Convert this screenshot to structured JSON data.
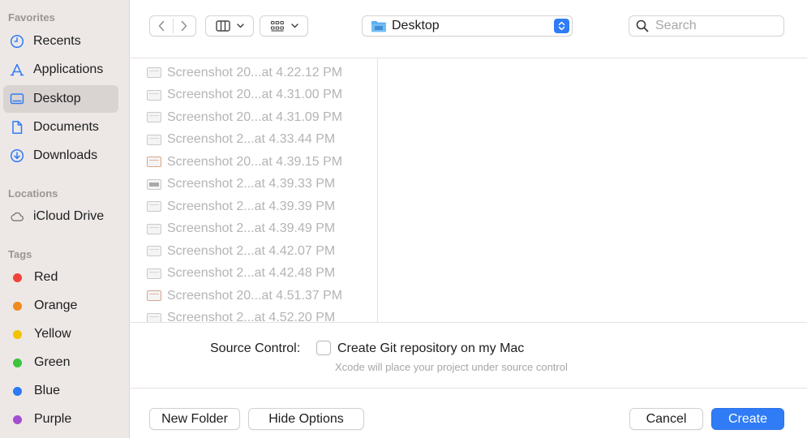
{
  "sidebar": {
    "favorites_header": "Favorites",
    "favorites": [
      {
        "label": "Recents",
        "icon": "clock-icon"
      },
      {
        "label": "Applications",
        "icon": "applications-icon"
      },
      {
        "label": "Desktop",
        "icon": "desktop-icon",
        "selected": true
      },
      {
        "label": "Documents",
        "icon": "document-icon"
      },
      {
        "label": "Downloads",
        "icon": "download-icon"
      }
    ],
    "locations_header": "Locations",
    "locations": [
      {
        "label": "iCloud Drive",
        "icon": "cloud-icon"
      }
    ],
    "tags_header": "Tags",
    "tags": [
      {
        "label": "Red",
        "color": "#f0443a"
      },
      {
        "label": "Orange",
        "color": "#f08a1c"
      },
      {
        "label": "Yellow",
        "color": "#f4c300"
      },
      {
        "label": "Green",
        "color": "#3cc43f"
      },
      {
        "label": "Blue",
        "color": "#2b7af6"
      },
      {
        "label": "Purple",
        "color": "#a34fd1"
      }
    ]
  },
  "toolbar": {
    "location": "Desktop",
    "search_placeholder": "Search"
  },
  "files": [
    {
      "name": "Screenshot 20...at 4.22.12 PM",
      "thumb": "light"
    },
    {
      "name": "Screenshot 20...at 4.31.00 PM",
      "thumb": "light"
    },
    {
      "name": "Screenshot 20...at 4.31.09 PM",
      "thumb": "light"
    },
    {
      "name": "Screenshot 2...at 4.33.44 PM",
      "thumb": "light"
    },
    {
      "name": "Screenshot 20...at 4.39.15 PM",
      "thumb": "orange"
    },
    {
      "name": "Screenshot 2...at 4.39.33 PM",
      "thumb": "dark"
    },
    {
      "name": "Screenshot 2...at 4.39.39 PM",
      "thumb": "light"
    },
    {
      "name": "Screenshot 2...at 4.39.49 PM",
      "thumb": "light"
    },
    {
      "name": "Screenshot 2...at 4.42.07 PM",
      "thumb": "light"
    },
    {
      "name": "Screenshot 2...at 4.42.48 PM",
      "thumb": "light"
    },
    {
      "name": "Screenshot 20...at 4.51.37 PM",
      "thumb": "orange"
    },
    {
      "name": "Screenshot 2...at 4.52.20 PM",
      "thumb": "light"
    }
  ],
  "options": {
    "source_control_label": "Source Control:",
    "git_checkbox_label": "Create Git repository on my Mac",
    "git_checkbox_checked": false,
    "git_hint": "Xcode will place your project under source control"
  },
  "buttons": {
    "new_folder": "New Folder",
    "hide_options": "Hide Options",
    "cancel": "Cancel",
    "create": "Create"
  },
  "colors": {
    "accent": "#2f7cf6",
    "sidebar_bg": "#ede8e6",
    "sidebar_selected": "#d9d4d2"
  }
}
